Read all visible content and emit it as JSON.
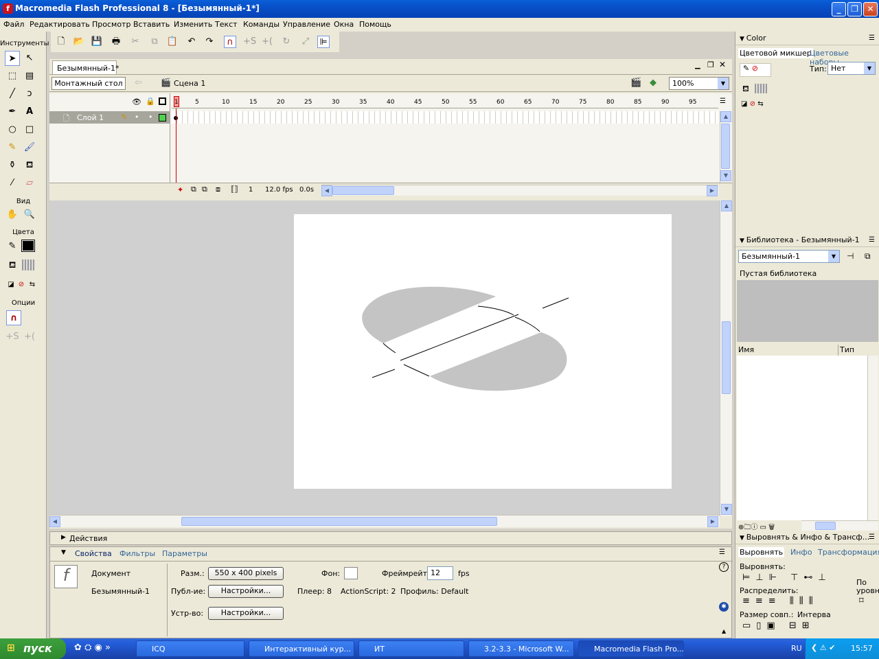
{
  "window": {
    "title": "Macromedia Flash Professional 8 - [Безымянный-1*]"
  },
  "menu": [
    "Файл",
    "Редактировать",
    "Просмотр",
    "Вставить",
    "Изменить",
    "Текст",
    "Команды",
    "Управление",
    "Окна",
    "Помощь"
  ],
  "tools": {
    "header": "Инструменты",
    "view_label": "Вид",
    "colors_label": "Цвета",
    "options_label": "Опции"
  },
  "document": {
    "tab": "Безымянный-1*",
    "edit_button": "Монтажный стол",
    "scene": "Сцена 1",
    "zoom": "100%"
  },
  "timeline": {
    "layer_name": "Слой 1",
    "ruler": [
      "1",
      "5",
      "10",
      "15",
      "20",
      "25",
      "30",
      "35",
      "40",
      "45",
      "50",
      "55",
      "60",
      "65",
      "70",
      "75",
      "80",
      "85",
      "90",
      "95"
    ],
    "current_frame": "1",
    "fps": "12.0 fps",
    "time": "0.0s"
  },
  "actions": {
    "label": "Действия"
  },
  "properties": {
    "tabs": [
      "Свойства",
      "Фильтры",
      "Параметры"
    ],
    "doc_label": "Документ",
    "doc_name": "Безымянный-1",
    "size_label": "Разм.:",
    "size_value": "550 x 400 pixels",
    "bg_label": "Фон:",
    "framerate_label": "Фреймрейт:",
    "framerate_value": "12",
    "fps_unit": "fps",
    "publish_label": "Публ-ие:",
    "settings_btn": "Настройки...",
    "player": "Плеер: 8",
    "actionscript": "ActionScript:  2",
    "profile": "Профиль: Default",
    "device_label": "Устр-во:",
    "device_btn": "Настройки..."
  },
  "color_panel": {
    "title": "Color",
    "tab_mixer": "Цветовой микшер",
    "tab_swatches": "Цветовые наборы",
    "type_label": "Тип:",
    "type_value": "Нет"
  },
  "library_panel": {
    "title": "Библиотека - Безымянный-1",
    "select": "Безымянный-1",
    "empty": "Пустая библиотека",
    "col_name": "Имя",
    "col_type": "Тип"
  },
  "align_panel": {
    "title": "Выровнять & Инфо & Трансф...",
    "tab_align": "Выровнять",
    "tab_info": "Инфо",
    "tab_transform": "Трансформация",
    "align_label": "Выровнять:",
    "distribute_label": "Распределить:",
    "match_size_label": "Размер совп.:",
    "space_label": "Интерва",
    "to_stage_1": "По",
    "to_stage_2": "уровни"
  },
  "taskbar": {
    "start": "пуск",
    "tasks": [
      "ICQ",
      "Интерактивный кур...",
      "ИТ",
      "3.2-3.3 - Microsoft W...",
      "Macromedia Flash Pro..."
    ],
    "lang": "RU",
    "clock": "15:57"
  }
}
